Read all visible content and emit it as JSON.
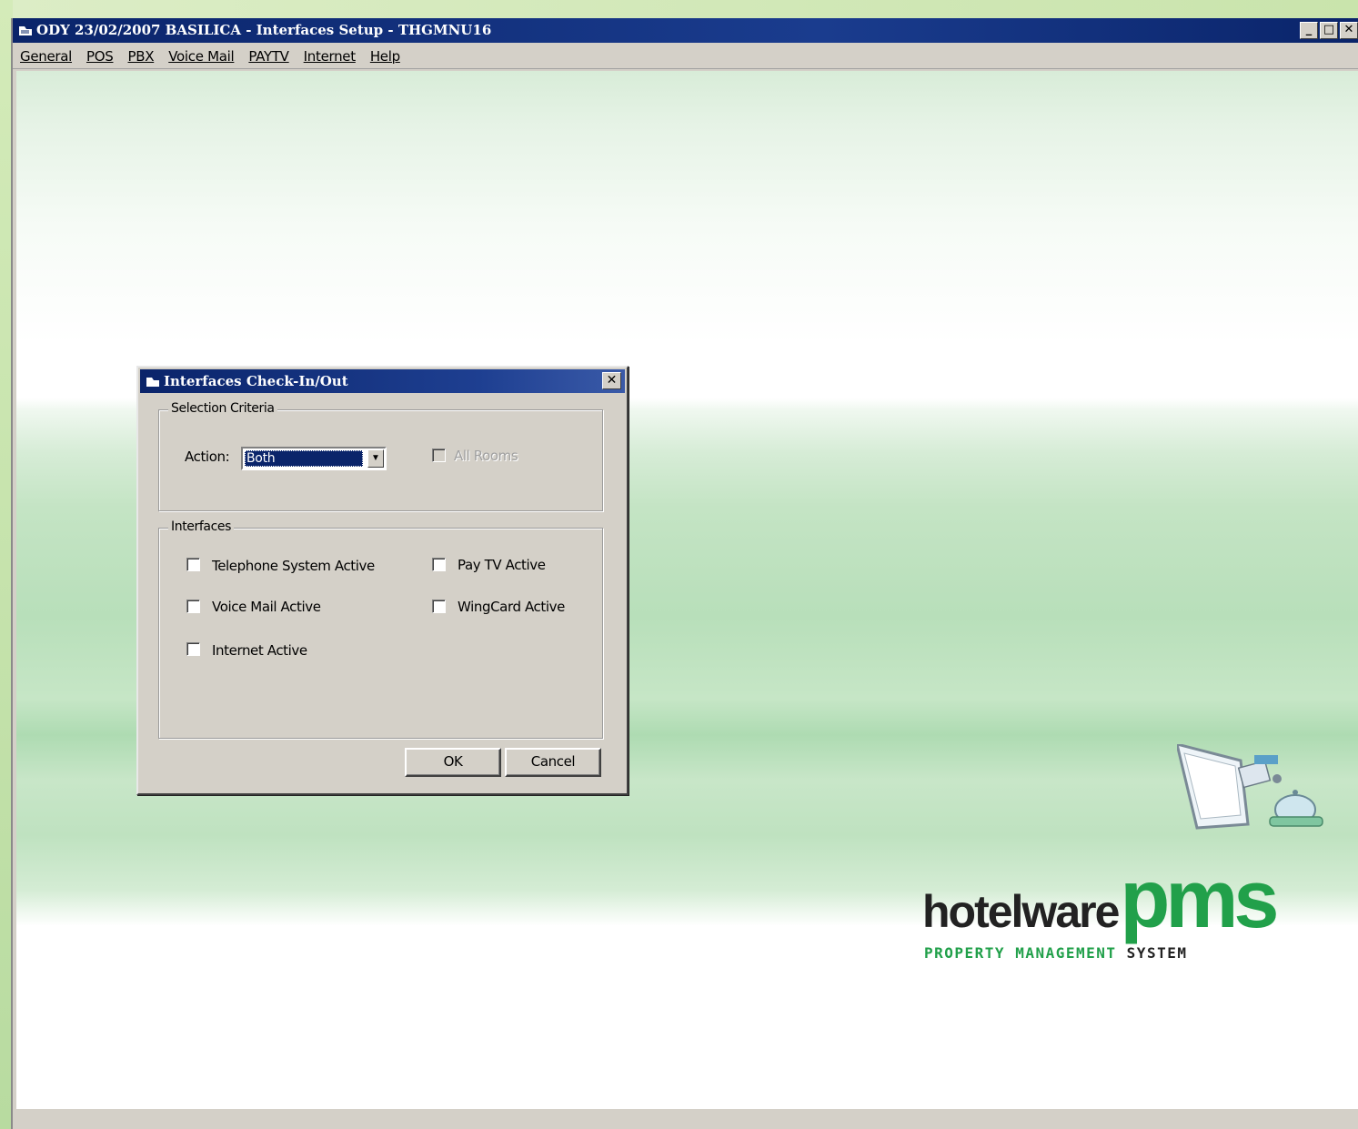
{
  "window": {
    "title": "ODY 23/02/2007 BASILICA - Interfaces Setup - THGMNU16",
    "controls": {
      "minimize": "_",
      "maximize": "□",
      "close": "✕"
    }
  },
  "menu": [
    "General",
    "POS",
    "PBX",
    "Voice Mail",
    "PAYTV",
    "Internet",
    "Help"
  ],
  "dialog": {
    "title": "Interfaces Check-In/Out",
    "close": "✕",
    "selection_group": "Selection Criteria",
    "action_label": "Action:",
    "action_value": "Both",
    "all_rooms": "All Rooms",
    "interfaces_group": "Interfaces",
    "checkboxes": {
      "telephone": "Telephone System Active",
      "paytv": "Pay TV Active",
      "voicemail": "Voice Mail Active",
      "wingcard": "WingCard Active",
      "internet": "Internet Active"
    },
    "ok": "OK",
    "cancel": "Cancel"
  },
  "logo": {
    "word1": "hotelware",
    "word2": "pms",
    "tag1": "PROPERTY MANAGEMENT",
    "tag2": "SYSTEM"
  },
  "colors": {
    "titlebar": "#0a246a",
    "brand_green": "#21a04a",
    "dialog_face": "#d4d0c8"
  }
}
